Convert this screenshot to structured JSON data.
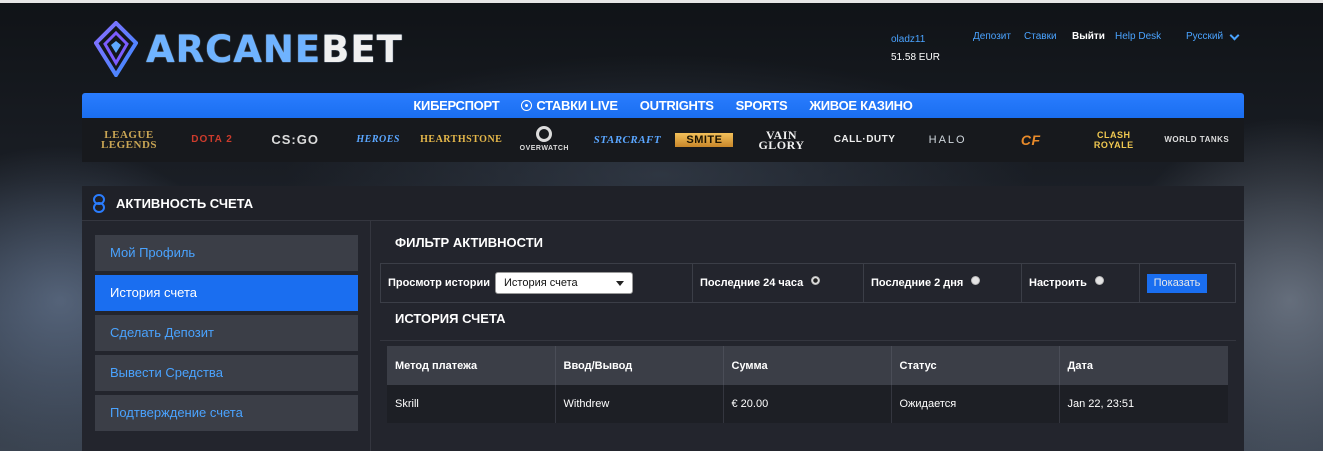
{
  "brand": {
    "logo_main": "ARCANE",
    "logo_accent": "BET",
    "accent_color": "#1a6ef0",
    "link_color": "#4aa3ff"
  },
  "account": {
    "username": "oladz11",
    "balance": "51.58 EUR"
  },
  "topnav": {
    "deposit": "Депозит",
    "bets": "Ставки",
    "logout": "Выйти",
    "help": "Help Desk",
    "language": "Русский"
  },
  "mainnav": {
    "esports": "КИБЕРСПОРТ",
    "live": "СТАВКИ LIVE",
    "outrights": "OUTRIGHTS",
    "sports": "SPORTS",
    "casino": "ЖИВОЕ КАЗИНО"
  },
  "games": {
    "lol": "LEAGUE LEGENDS",
    "dota": "DOTA 2",
    "csgo": "CS:GO",
    "heroes": "HEROES",
    "hearthstone": "HEARTHSTONE",
    "overwatch": "OVERWATCH",
    "starcraft": "STARCRAFT",
    "smite": "SMITE",
    "vainglory": "VAIN GLORY",
    "cod": "CALL·DUTY",
    "halo": "HALO",
    "crossfire": "CF",
    "clash": "CLASH ROYALE",
    "wot": "WORLD TANKS"
  },
  "panel": {
    "title": "АКТИВНОСТЬ СЧЕТА"
  },
  "sidebar": {
    "items": [
      {
        "label": "Мой Профиль"
      },
      {
        "label": "История счета"
      },
      {
        "label": "Сделать Депозит"
      },
      {
        "label": "Вывести Средства"
      },
      {
        "label": "Подтверждение счета"
      }
    ]
  },
  "filter": {
    "title": "ФИЛЬТР АКТИВНОСТИ",
    "history_label": "Просмотр истории",
    "history_value": "История счета",
    "opt_24h": "Последние 24 часа",
    "opt_2d": "Последние 2 дня",
    "opt_custom": "Настроить",
    "show_button": "Показать"
  },
  "history": {
    "title": "ИСТОРИЯ СЧЕТА",
    "columns": [
      "Метод платежа",
      "Ввод/Вывод",
      "Сумма",
      "Статус",
      "Дата"
    ],
    "rows": [
      [
        "Skrill",
        "Withdrew",
        "€ 20.00",
        "Ожидается",
        "Jan 22, 23:51"
      ]
    ]
  }
}
